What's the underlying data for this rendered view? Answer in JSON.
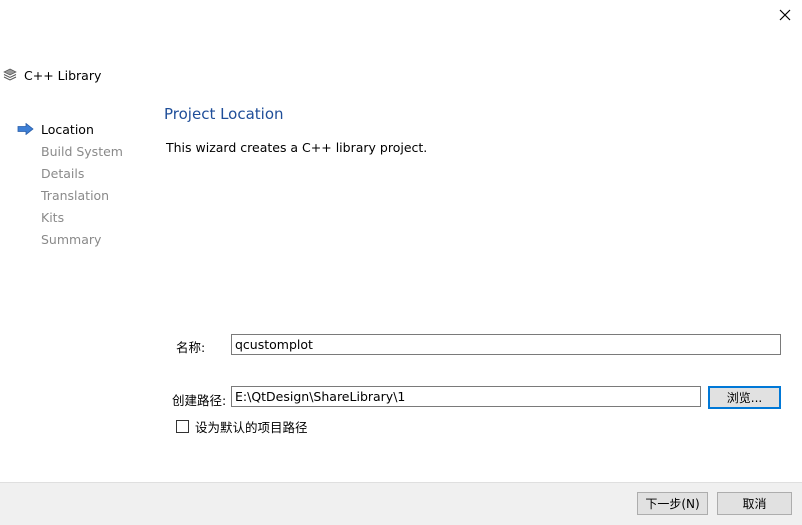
{
  "window": {
    "title": "C++ Library",
    "close_icon": "close-icon"
  },
  "steps": [
    {
      "label": "Location",
      "current": true
    },
    {
      "label": "Build System",
      "current": false
    },
    {
      "label": "Details",
      "current": false
    },
    {
      "label": "Translation",
      "current": false
    },
    {
      "label": "Kits",
      "current": false
    },
    {
      "label": "Summary",
      "current": false
    }
  ],
  "page": {
    "title": "Project Location",
    "description": "This wizard creates a C++ library project."
  },
  "form": {
    "name_label": "名称:",
    "name_value": "qcustomplot",
    "path_label": "创建路径:",
    "path_value": "E:\\QtDesign\\ShareLibrary\\1",
    "browse_label": "浏览...",
    "default_path_label": "设为默认的项目路径",
    "default_path_checked": false
  },
  "footer": {
    "next_label": "下一步(N)",
    "cancel_label": "取消"
  },
  "colors": {
    "title": "#1f4e99",
    "step_inactive": "#8a8a8a",
    "arrow": "#3d7fd6",
    "focus": "#0078d7"
  }
}
